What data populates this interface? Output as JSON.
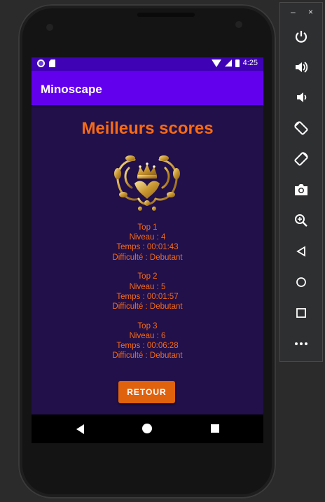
{
  "status_bar": {
    "time": "4:25"
  },
  "app_bar": {
    "title": "Minoscape"
  },
  "page": {
    "title": "Meilleurs scores"
  },
  "scores": [
    {
      "rank": "Top 1",
      "level": "Niveau : 4",
      "time": "Temps : 00:01:43",
      "difficulty": "Difficulté : Debutant"
    },
    {
      "rank": "Top 2",
      "level": "Niveau : 5",
      "time": "Temps : 00:01:57",
      "difficulty": "Difficulté : Debutant"
    },
    {
      "rank": "Top 3",
      "level": "Niveau : 6",
      "time": "Temps : 00:06:28",
      "difficulty": "Difficulté : Debutant"
    }
  ],
  "buttons": {
    "retour": "RETOUR"
  },
  "toolbar": {
    "minimize": "–",
    "close": "×",
    "items": [
      "power-icon",
      "volume-up-icon",
      "volume-down-icon",
      "rotate-left-icon",
      "rotate-right-icon",
      "camera-icon",
      "zoom-icon",
      "back-icon",
      "home-icon",
      "overview-icon",
      "more-icon"
    ]
  },
  "colors": {
    "primary": "#6200ee",
    "primary_dark": "#3f02b5",
    "background": "#22104a",
    "accent": "#f76b15",
    "button": "#e0620d"
  }
}
